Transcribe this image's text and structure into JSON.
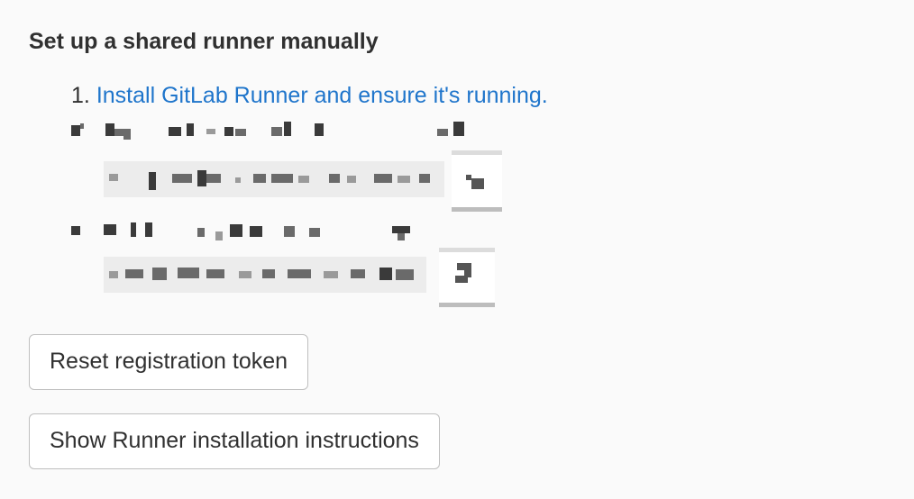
{
  "section": {
    "title": "Set up a shared runner manually"
  },
  "steps": {
    "step1_number": "1.",
    "step1_link": "Install GitLab Runner and ensure it's running."
  },
  "buttons": {
    "reset_token": "Reset registration token",
    "show_instructions": "Show Runner installation instructions"
  },
  "icons": {
    "copy_icon_1": "copy-icon",
    "copy_icon_2": "copy-icon"
  },
  "colors": {
    "link": "#1f75cb",
    "text": "#303030",
    "background": "#fafafa"
  }
}
